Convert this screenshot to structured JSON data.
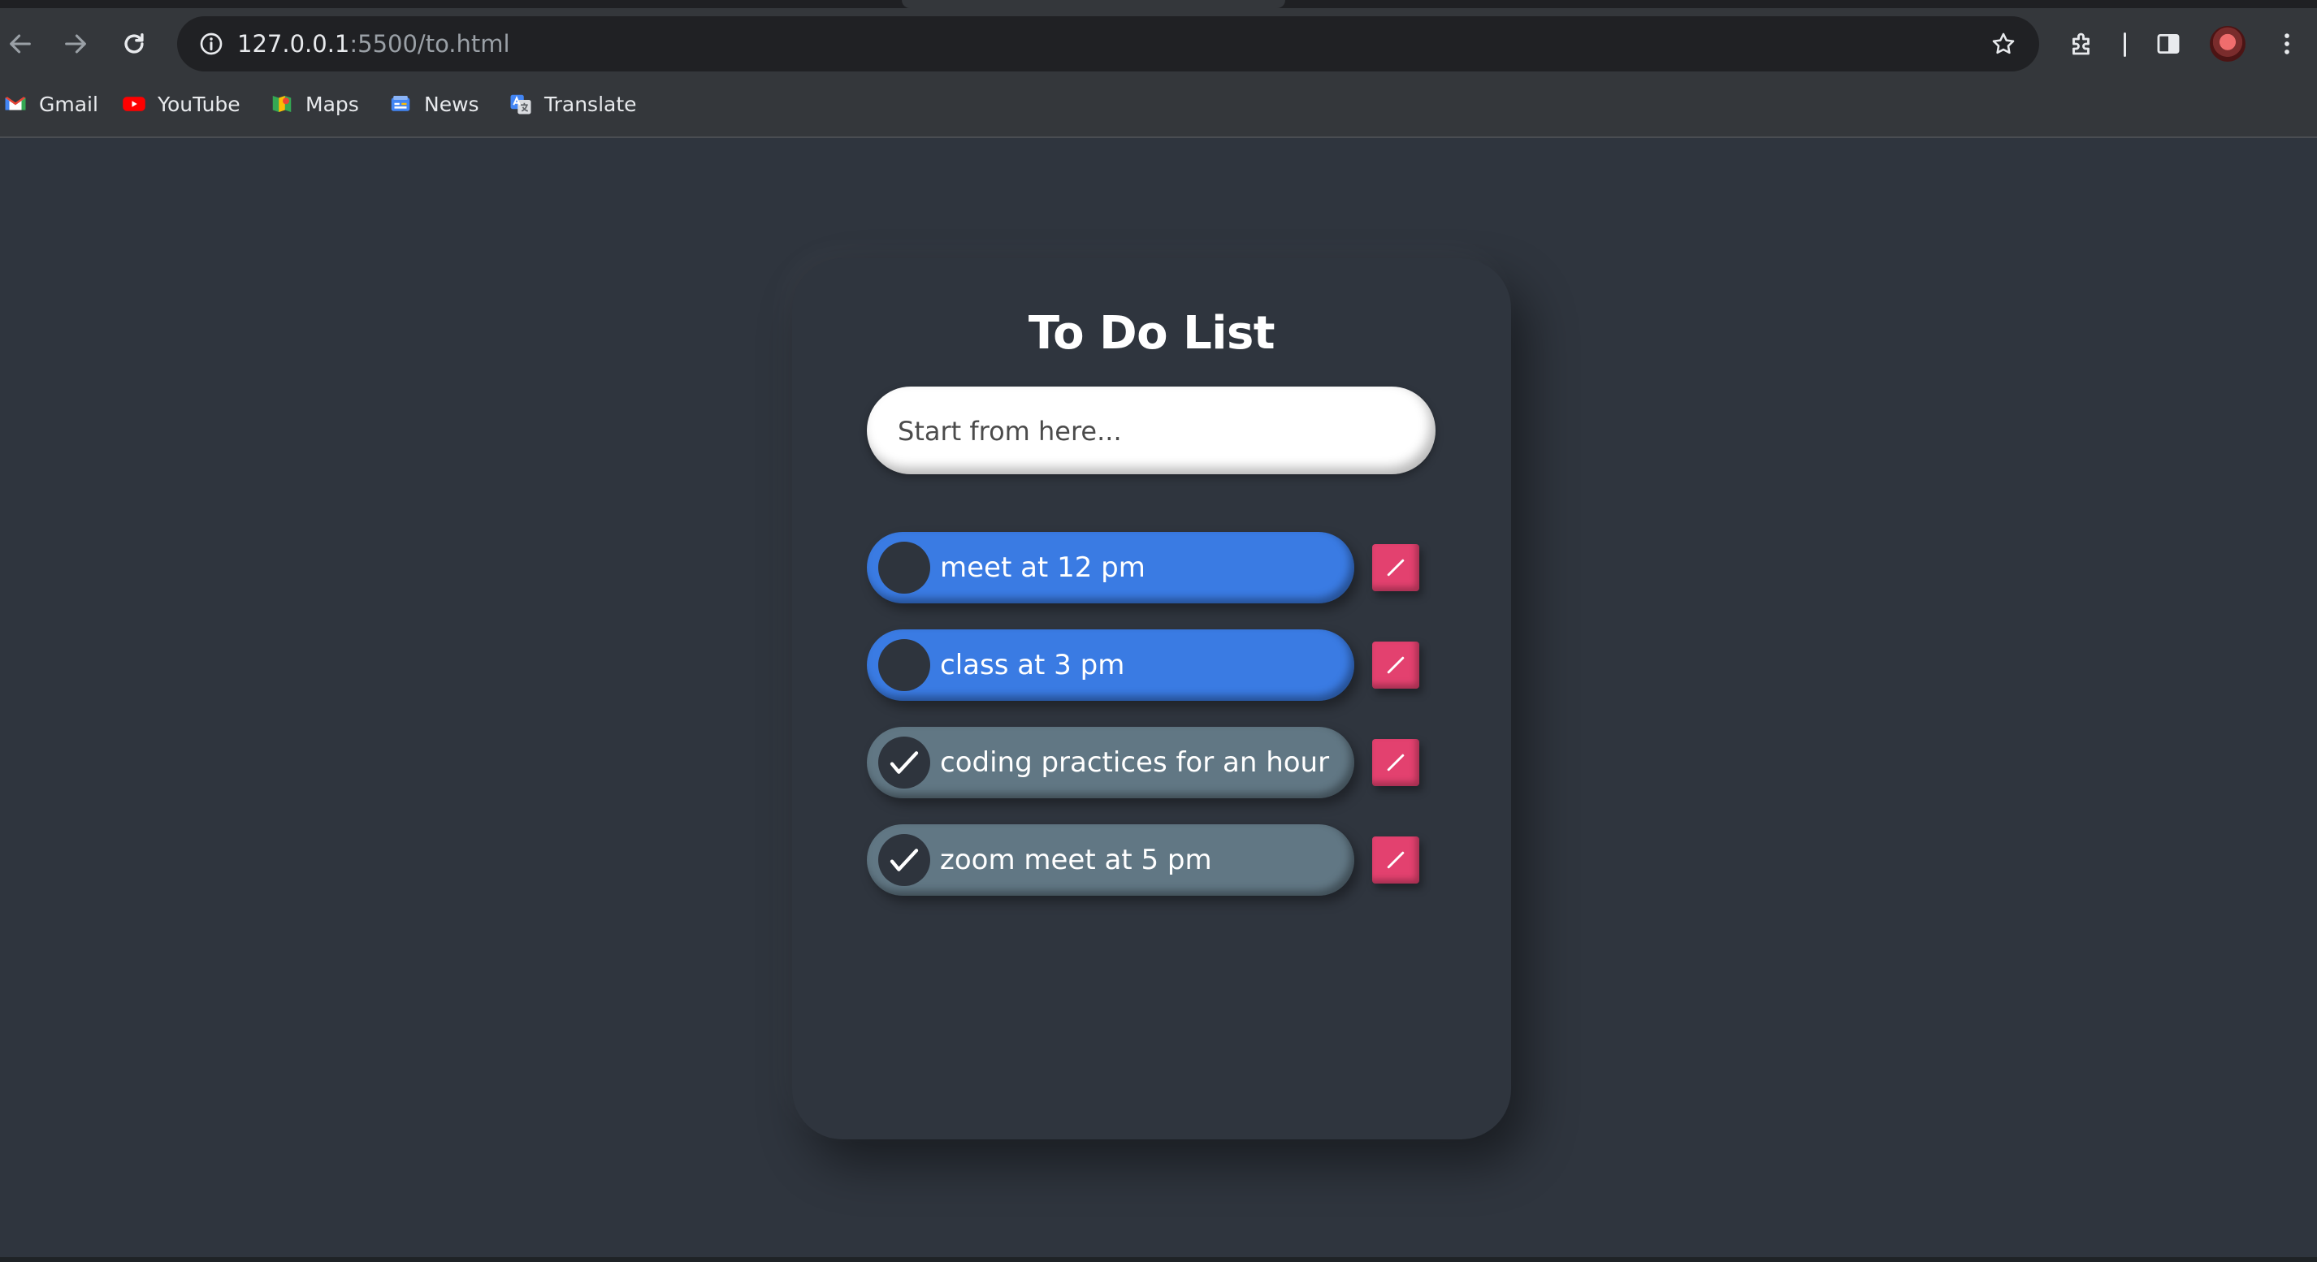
{
  "browser": {
    "url_host": "127.0.0.1",
    "url_path": ":5500/to.html",
    "icons": {
      "back": "arrow-left-icon",
      "forward": "arrow-right-icon",
      "reload": "reload-icon",
      "site_info": "info-icon",
      "bookmark_star": "star-icon",
      "extensions": "puzzle-icon",
      "side_panel": "side-panel-icon",
      "menu": "kebab-menu-icon"
    },
    "bookmarks": [
      {
        "label": "Gmail",
        "icon": "gmail-icon",
        "color": "#ea4335"
      },
      {
        "label": "YouTube",
        "icon": "youtube-icon",
        "color": "#ff0000"
      },
      {
        "label": "Maps",
        "icon": "maps-icon",
        "color": "#34a853"
      },
      {
        "label": "News",
        "icon": "news-icon",
        "color": "#4285f4"
      },
      {
        "label": "Translate",
        "icon": "translate-icon",
        "color": "#4285f4"
      }
    ]
  },
  "app": {
    "title": "To Do List",
    "input": {
      "placeholder": "Start from here...",
      "value": ""
    },
    "tasks": [
      {
        "text": "meet at 12 pm",
        "done": false
      },
      {
        "text": "class at 3 pm",
        "done": false
      },
      {
        "text": "coding practices for an hour",
        "done": true
      },
      {
        "text": "zoom meet at 5 pm",
        "done": true
      }
    ],
    "colors": {
      "background": "#2f353e",
      "task_active": "#3a7be3",
      "task_done": "#617784",
      "edit_button": "#e3416f"
    },
    "edit_icon": "pencil-line-icon",
    "check_icon": "checkmark-icon"
  }
}
